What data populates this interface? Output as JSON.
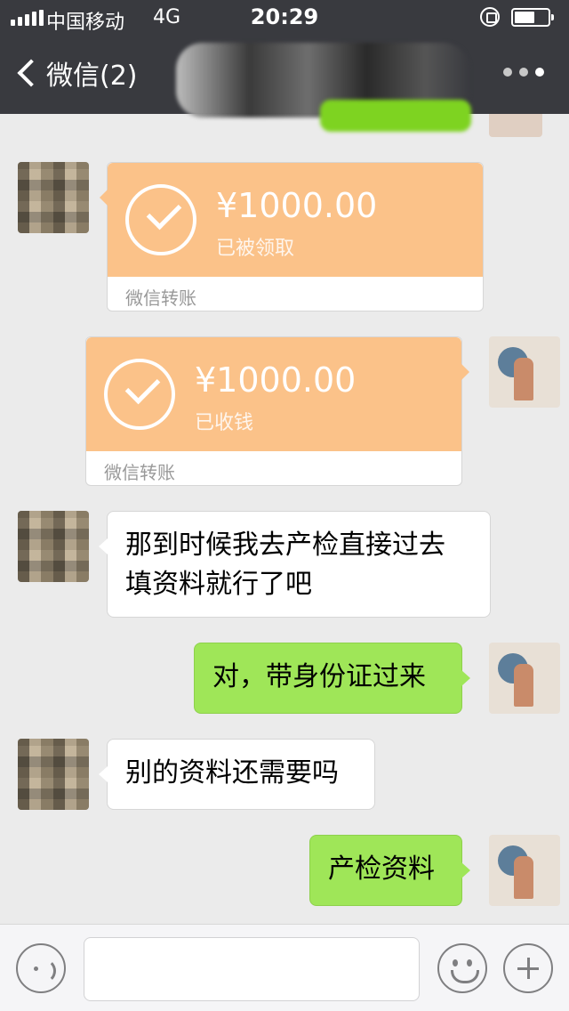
{
  "status_bar": {
    "carrier": "中国移动",
    "network": "4G",
    "time": "20:29"
  },
  "nav": {
    "back_label": "微信(2)"
  },
  "messages": [
    {
      "type": "transfer",
      "side": "in",
      "amount": "¥1000.00",
      "status": "已被领取",
      "footer": "微信转账"
    },
    {
      "type": "transfer",
      "side": "out",
      "amount": "¥1000.00",
      "status": "已收钱",
      "footer": "微信转账"
    },
    {
      "type": "text",
      "side": "in",
      "lines": [
        "那到时候我去产检直接过去",
        "填资料就行了吧"
      ]
    },
    {
      "type": "text",
      "side": "out",
      "text": "对，带身份证过来"
    },
    {
      "type": "text",
      "side": "in",
      "text": "别的资料还需要吗"
    },
    {
      "type": "text",
      "side": "out",
      "text": "产检资料"
    }
  ],
  "colors": {
    "nav_bg": "#393a3f",
    "chat_bg": "#ebebeb",
    "transfer_orange": "#fbc289",
    "outgoing_green": "#9fe658"
  },
  "icons": {
    "back": "chevron-left-icon",
    "more": "more-dots-icon",
    "voice": "voice-icon",
    "emoji": "emoji-icon",
    "plus": "plus-icon"
  }
}
